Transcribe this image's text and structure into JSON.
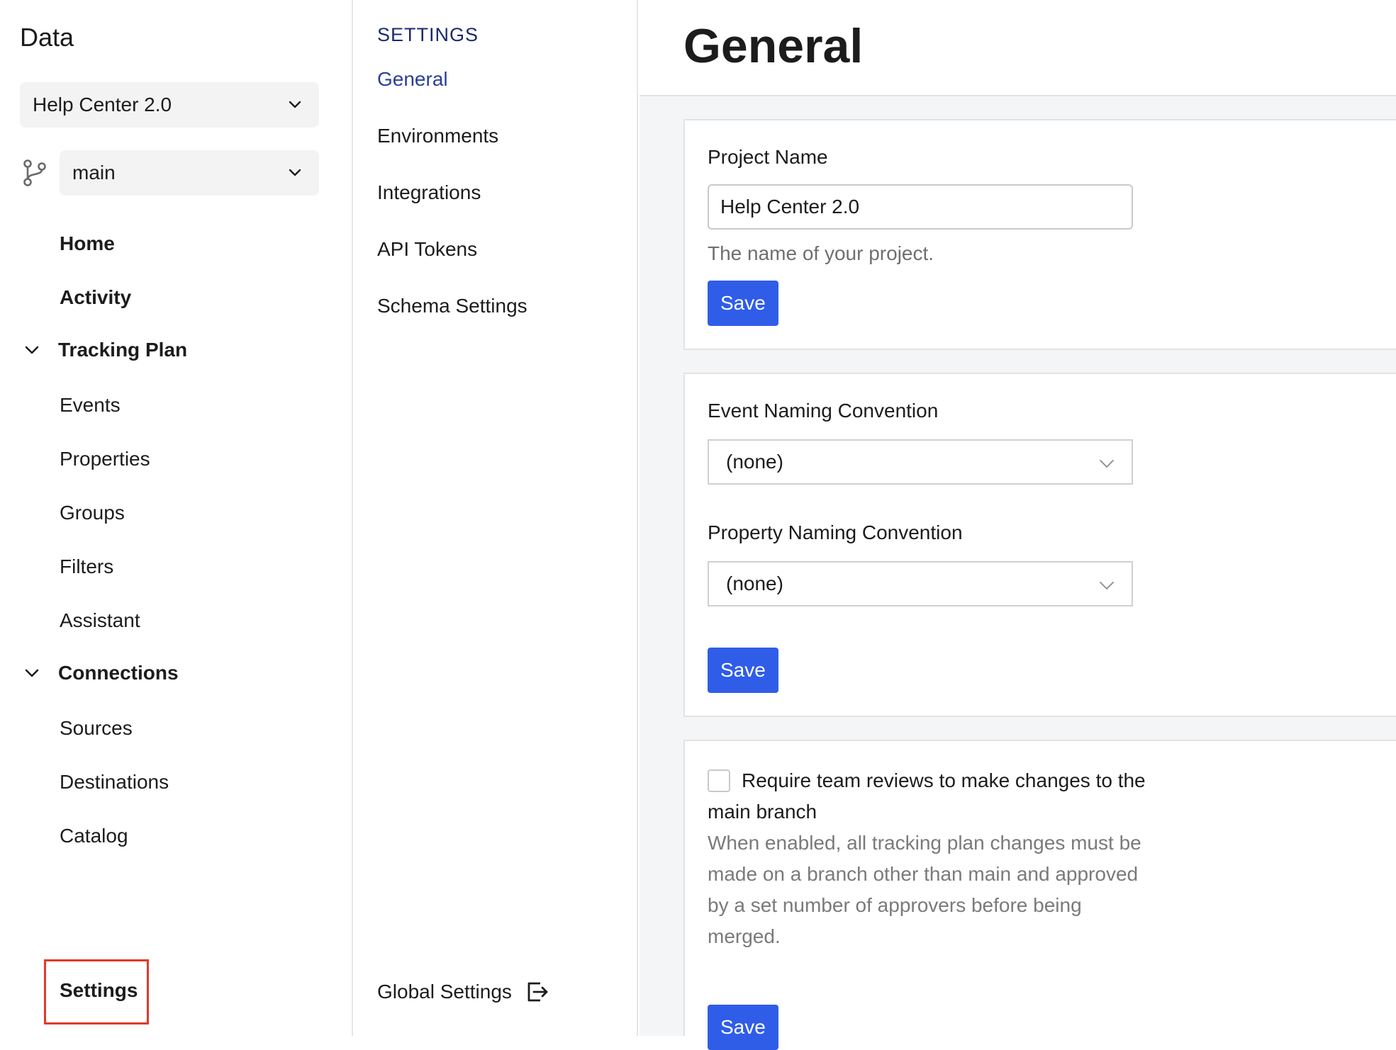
{
  "sidebar": {
    "brand": "Data",
    "project_select": {
      "value": "Help Center 2.0"
    },
    "branch_select": {
      "value": "main"
    },
    "top_items": [
      {
        "label": "Home"
      },
      {
        "label": "Activity"
      }
    ],
    "groups": [
      {
        "label": "Tracking Plan",
        "items": [
          "Events",
          "Properties",
          "Groups",
          "Filters",
          "Assistant"
        ]
      },
      {
        "label": "Connections",
        "items": [
          "Sources",
          "Destinations",
          "Catalog"
        ]
      }
    ],
    "settings_label": "Settings",
    "highlight_color": "#e03a2b"
  },
  "subnav": {
    "heading": "SETTINGS",
    "items": [
      {
        "label": "General",
        "active": true
      },
      {
        "label": "Environments"
      },
      {
        "label": "Integrations"
      },
      {
        "label": "API Tokens"
      },
      {
        "label": "Schema Settings"
      }
    ],
    "global_settings_label": "Global Settings",
    "global_settings_icon": "external-link-icon"
  },
  "main": {
    "title": "General",
    "project_name_card": {
      "label": "Project Name",
      "value": "Help Center 2.0",
      "help": "The name of your project.",
      "save_label": "Save"
    },
    "naming_card": {
      "event_label": "Event Naming Convention",
      "event_value": "(none)",
      "property_label": "Property Naming Convention",
      "property_value": "(none)",
      "save_label": "Save"
    },
    "review_card": {
      "checkbox_label": "Require team reviews to make changes to the main branch",
      "description": "When enabled, all tracking plan changes must be made on a branch other than main and approved by a set number of approvers before being merged.",
      "save_label": "Save"
    }
  },
  "colors": {
    "primary_button": "#2f5de8",
    "active_link": "#2c3e99",
    "heading": "#1b2a6b",
    "page_background": "#f4f5f6"
  }
}
